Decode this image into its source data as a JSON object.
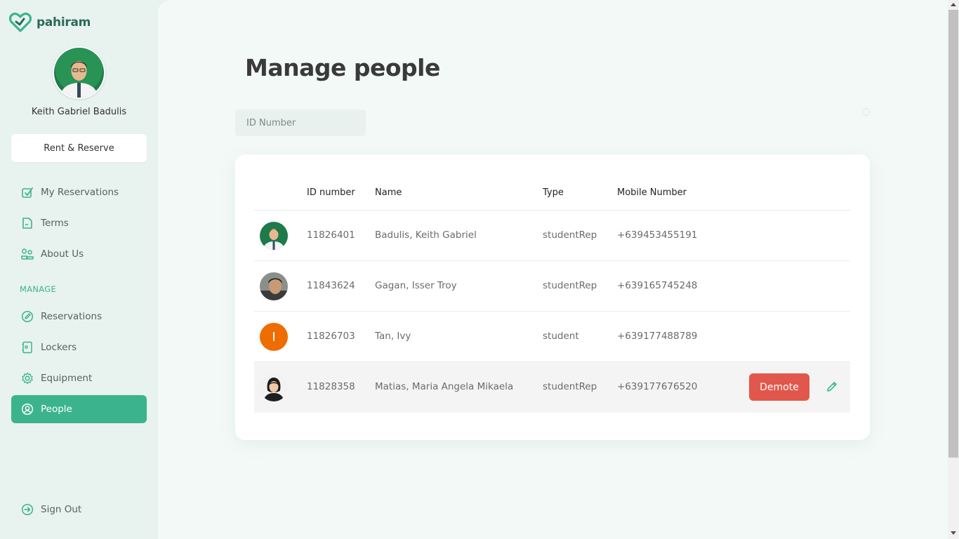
{
  "app": {
    "name": "pahiram",
    "accent": "#3bb38d",
    "danger": "#e2574c"
  },
  "sidebar": {
    "user_name": "Keith Gabriel Badulis",
    "rent_button": "Rent & Reserve",
    "items": [
      {
        "label": "My Reservations",
        "icon": "check-badge-icon"
      },
      {
        "label": "Terms",
        "icon": "document-icon"
      },
      {
        "label": "About Us",
        "icon": "people-icon"
      }
    ],
    "manage_label": "MANAGE",
    "manage_items": [
      {
        "label": "Reservations",
        "icon": "pen-circle-icon"
      },
      {
        "label": "Lockers",
        "icon": "locker-icon"
      },
      {
        "label": "Equipment",
        "icon": "gear-icon"
      },
      {
        "label": "People",
        "icon": "user-circle-icon",
        "active": true
      }
    ],
    "sign_out": "Sign Out"
  },
  "main": {
    "title": "Manage people",
    "search": {
      "placeholder": "ID Number",
      "value": ""
    },
    "table": {
      "columns": [
        "ID number",
        "Name",
        "Type",
        "Mobile Number"
      ],
      "rows": [
        {
          "id": "11826401",
          "name": "Badulis, Keith Gabriel",
          "type": "studentRep",
          "mobile": "+639453455191",
          "avatar": "photo"
        },
        {
          "id": "11843624",
          "name": "Gagan, Isser Troy",
          "type": "studentRep",
          "mobile": "+639165745248",
          "avatar": "photo"
        },
        {
          "id": "11826703",
          "name": "Tan, Ivy",
          "type": "student",
          "mobile": "+639177488789",
          "avatar": "I",
          "avatar_color": "#ef6c00"
        },
        {
          "id": "11828358",
          "name": "Matias, Maria Angela Mikaela",
          "type": "studentRep",
          "mobile": "+639177676520",
          "avatar": "photo",
          "hovered": true,
          "action": "Demote"
        }
      ]
    }
  }
}
